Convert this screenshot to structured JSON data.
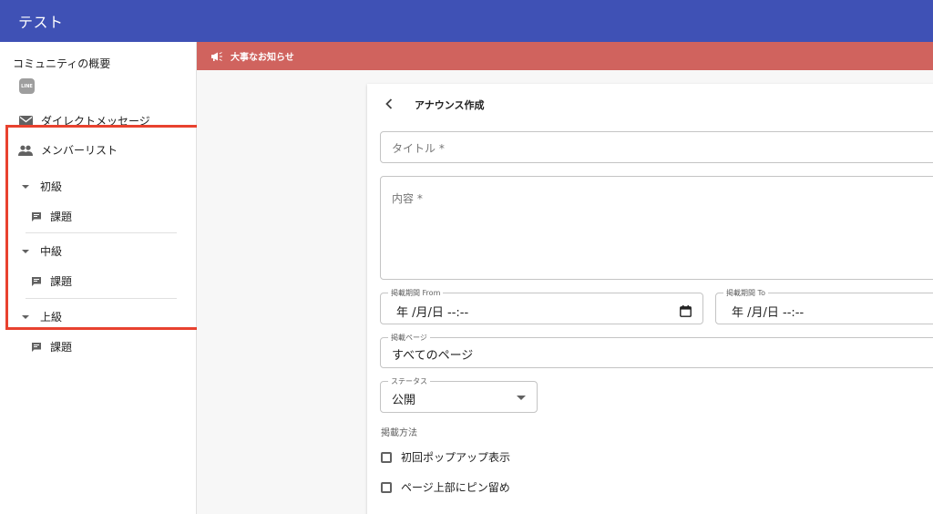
{
  "app": {
    "title": "テスト"
  },
  "sidebar": {
    "community_title": "コミュニティの概要",
    "line_badge": "LINE",
    "nav": [
      {
        "label": "ダイレクトメッセージ",
        "icon": "mail-icon"
      },
      {
        "label": "メンバーリスト",
        "icon": "people-icon"
      }
    ],
    "groups": [
      {
        "label": "初級",
        "items": [
          {
            "label": "課題",
            "icon": "chat-icon"
          }
        ]
      },
      {
        "label": "中級",
        "items": [
          {
            "label": "課題",
            "icon": "chat-icon"
          }
        ]
      },
      {
        "label": "上級",
        "items": [
          {
            "label": "課題",
            "icon": "chat-icon"
          }
        ]
      }
    ]
  },
  "banner": {
    "text": "大事なお知らせ",
    "icon": "megaphone-icon",
    "color": "#d0635e"
  },
  "form": {
    "title": "アナウンス作成",
    "title_field": {
      "placeholder": "タイトル *"
    },
    "content_field": {
      "placeholder": "内容 *"
    },
    "period_from": {
      "label": "掲載期間 From",
      "value": "年 /月/日 --:--"
    },
    "period_to": {
      "label": "掲載期間 To",
      "value": "年 /月/日 --:--"
    },
    "page": {
      "label": "掲載ページ",
      "value": "すべてのページ"
    },
    "status": {
      "label": "ステータス",
      "value": "公開"
    },
    "method": {
      "label": "掲載方法",
      "options": [
        {
          "label": "初回ポップアップ表示",
          "checked": false
        },
        {
          "label": "ページ上部にピン留め",
          "checked": false
        }
      ]
    }
  },
  "colors": {
    "appbar": "#3f51b5",
    "highlight_border": "#e8422f"
  }
}
